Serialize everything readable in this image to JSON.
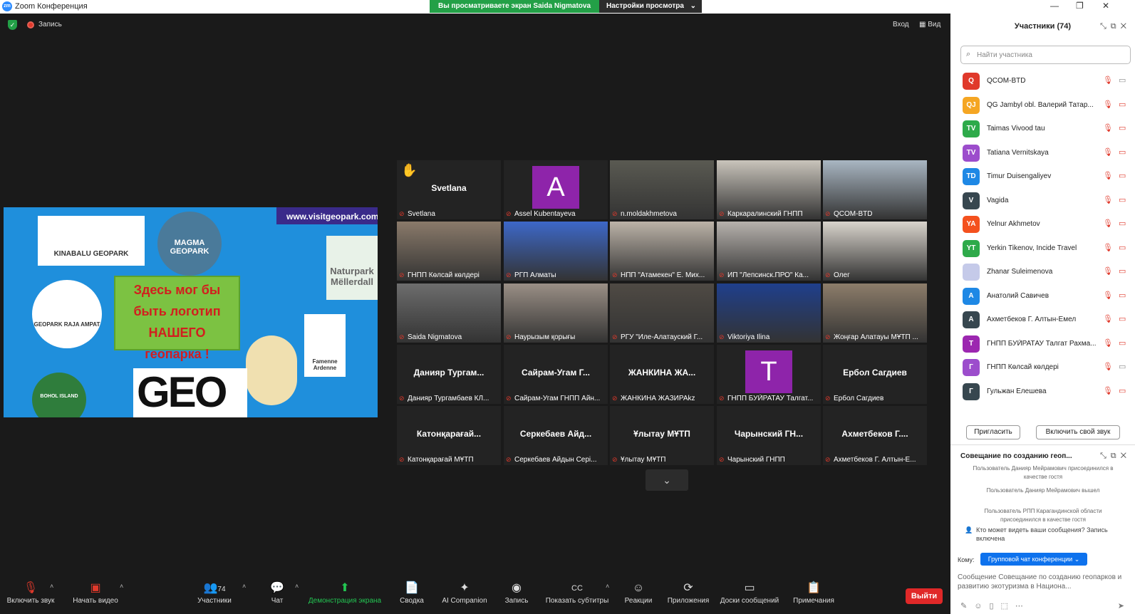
{
  "titlebar": {
    "app_logo": "zm",
    "app_title": "Zoom Конференция",
    "share_notice": "Вы просматриваете экран Saida Nigmatova",
    "view_settings": "Настройки просмотра",
    "window_controls": [
      "—",
      "❐",
      "✕"
    ]
  },
  "topbar": {
    "recording_label": "Запись",
    "login_label": "Вход",
    "view_label": "Вид"
  },
  "shared_screen": {
    "visit_banner": "www.visitgeopark.com",
    "sticky_text": [
      "Здесь мог бы",
      "быть логотип",
      "НАШЕГО",
      "геопарка !"
    ],
    "logos": [
      "KINABALU GEOPARK",
      "MAGMA GEOPARK",
      "GEOPARK RAJA AMPAT",
      "Famenne Ardenne",
      "BOHOL ISLAND",
      "Naturpark Mëllerdall"
    ],
    "geo_text": "GEO"
  },
  "video_tiles": [
    {
      "big": "Svetlana",
      "label": "Svetlana",
      "hand": "✋"
    },
    {
      "letter": "A",
      "label": "Assel Kubentayeva",
      "color": "#8e24aa"
    },
    {
      "photo": "#5a5a52",
      "label": "n.moldakhmetova"
    },
    {
      "photo": "#c9c4bb",
      "label": "Каркаралинский ГНПП"
    },
    {
      "photo": "#a9b6c2",
      "label": "QCOM-BTD"
    },
    {
      "photo": "#8a7a6a",
      "label": "ГНПП Көлсай көлдері"
    },
    {
      "photo": "#3d68c8",
      "label": "РГП Алматы"
    },
    {
      "photo": "#bcb3a8",
      "label": "НПП \"Атамекен\" Е. Мих..."
    },
    {
      "photo": "#b7b2ad",
      "label": "ИП \"Лепсинск.ПРО\" Ка..."
    },
    {
      "photo": "#d9d4cc",
      "label": "Олег"
    },
    {
      "photo": "#6d6d6d",
      "label": "Saida Nigmatova"
    },
    {
      "photo": "#9a8f86",
      "label": "Наурызым қорығы"
    },
    {
      "photo": "#4f4a44",
      "label": "РГУ \"Иле-Алатауский Г..."
    },
    {
      "photo": "#1f3f8c",
      "label": "Viktoriya Ilina",
      "active": true
    },
    {
      "photo": "#8d7d6a",
      "label": "Жоңғар Алатауы МҰТП ..."
    },
    {
      "big": "Данияр Тургам...",
      "label": "Данияр Тургамбаев КЛ..."
    },
    {
      "big": "Сайрам-Угам Г...",
      "label": "Сайрам-Угам ГНПП Айн..."
    },
    {
      "big": "ЖАНКИНА ЖА...",
      "label": "ЖАНКИНА ЖАЗИРАkz"
    },
    {
      "letter": "T",
      "label": "ГНПП БУЙРАТАУ Талгат...",
      "color": "#8e24aa"
    },
    {
      "big": "Ербол Сагдиев",
      "label": "Ербол Сагдиев"
    },
    {
      "big": "Катонқарағай...",
      "label": "Катонқарағай МҰТП"
    },
    {
      "big": "Серкебаев Айд...",
      "label": "Серкебаев Айдын Серi..."
    },
    {
      "big": "Ұлытау МҰТП",
      "label": "Ұлытау МҰТП"
    },
    {
      "big": "Чарынский ГН...",
      "label": "Чарынский ГНПП"
    },
    {
      "big": "Ахметбеков Г....",
      "label": "Ахметбеков Г. Алтын-Е..."
    }
  ],
  "toolbar": {
    "unmute": "Включить звук",
    "start_video": "Начать видео",
    "participants": "Участники",
    "participants_count": "74",
    "chat": "Чат",
    "share_screen": "Демонстрация экрана",
    "summary": "Сводка",
    "ai_companion": "AI Companion",
    "record": "Запись",
    "captions": "Показать субтитры",
    "reactions": "Реакции",
    "apps": "Приложения",
    "whiteboards": "Доски сообщений",
    "notes": "Примечания",
    "leave": "Выйти"
  },
  "participants_panel": {
    "title": "Участники (74)",
    "search_placeholder": "Найти участника",
    "items": [
      {
        "initials": "Q",
        "name": "QCOM-BTD",
        "color": "#e0392b",
        "cam": "on"
      },
      {
        "initials": "QJ",
        "name": "QG Jambyl obl. Валерий Татар...",
        "color": "#f5a623",
        "cam": "off"
      },
      {
        "initials": "TV",
        "name": "Taimas Vivood tau",
        "color": "#2eaa4a",
        "cam": "off"
      },
      {
        "initials": "TV",
        "name": "Tatiana Vernitskaya",
        "color": "#9c4dcc",
        "cam": "off"
      },
      {
        "initials": "TD",
        "name": "Timur Duisengaliyev",
        "color": "#1e88e5",
        "cam": "off"
      },
      {
        "initials": "V",
        "name": "Vagida",
        "color": "#37474f",
        "cam": "off"
      },
      {
        "initials": "YA",
        "name": "Yelnur Akhmetov",
        "color": "#f4511e",
        "cam": "off"
      },
      {
        "initials": "YT",
        "name": "Yerkin Tikenov, Incide Travel",
        "color": "#2eaa4a",
        "cam": "off"
      },
      {
        "initials": "",
        "name": "Zhanar Suleimenova",
        "color": "#c5cae9",
        "cam": "off"
      },
      {
        "initials": "А",
        "name": "Анатолий Савичев",
        "color": "#1e88e5",
        "cam": "off"
      },
      {
        "initials": "А",
        "name": "Ахметбеков Г. Алтын-Емел",
        "color": "#37474f",
        "cam": "off"
      },
      {
        "initials": "Т",
        "name": "ГНПП БУЙРАТАУ Талгат Рахма...",
        "color": "#9c27b0",
        "cam": "off"
      },
      {
        "initials": "Г",
        "name": "ГНПП Көлсай көлдері",
        "color": "#9c4dcc",
        "cam": "on"
      },
      {
        "initials": "Г",
        "name": "Гульжан Елешева",
        "color": "#37474f",
        "cam": "off"
      }
    ],
    "invite_button": "Пригласить",
    "unmute_self_button": "Включить свой звук"
  },
  "chat_panel": {
    "title": "Совещание по созданию геоп...",
    "messages": [
      "Пользователь Данияр Мейрамович присоединился в качестве гостя",
      "Пользователь Данияр Мейрамович вышел",
      "Пользователь РПП Карагандинской области присоединился в качестве гостя"
    ],
    "notice": "Кто может видеть ваши сообщения? Запись включена",
    "to_label": "Кому:",
    "to_value": "Групповой чат конференции ⌄",
    "input_placeholder": "Сообщение Совещание по созданию геопарков и развитию экотуризма в Национа..."
  }
}
